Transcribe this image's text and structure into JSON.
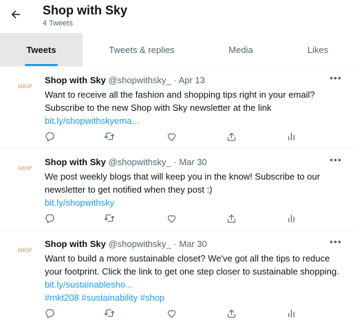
{
  "header": {
    "title": "Shop with Sky",
    "subtitle": "4 Tweets"
  },
  "tabs": [
    {
      "label": "Tweets",
      "active": true
    },
    {
      "label": "Tweets & replies",
      "active": false
    },
    {
      "label": "Media",
      "active": false
    },
    {
      "label": "Likes",
      "active": false
    }
  ],
  "avatar_text": "SHOP",
  "tweets": [
    {
      "name": "Shop with Sky",
      "handle": "@shopwithsky_",
      "separator": "·",
      "date": "Apr 13",
      "line1": "Want to receive all the fashion and shopping tips right in your email?",
      "line2": "Subscribe to the new Shop with Sky newsletter at the link",
      "link": "bit.ly/shopwithskyema..."
    },
    {
      "name": "Shop with Sky",
      "handle": "@shopwithsky_",
      "separator": "·",
      "date": "Mar 30",
      "line1": "We post weekly blogs that will keep you in the know! Subscribe to our",
      "line2": "newsletter to get notified when they post :)",
      "link": "bit.ly/shopwithsky"
    },
    {
      "name": "Shop with Sky",
      "handle": "@shopwithsky_",
      "separator": "·",
      "date": "Mar 30",
      "line1": "Want to build a more sustainable closet? We've got all the tips to reduce",
      "line2": "your footprint. Click the link to get one step closer to sustainable shopping.",
      "link": "bit.ly/sustainablesho...",
      "hashtags": "#mkt208 #sustainability #shop"
    }
  ],
  "more_label": "•••",
  "colors": {
    "accent": "#1d9bf0",
    "text": "#0f1419",
    "muted": "#536471",
    "active_tab_bg": "#e7e7e8"
  }
}
